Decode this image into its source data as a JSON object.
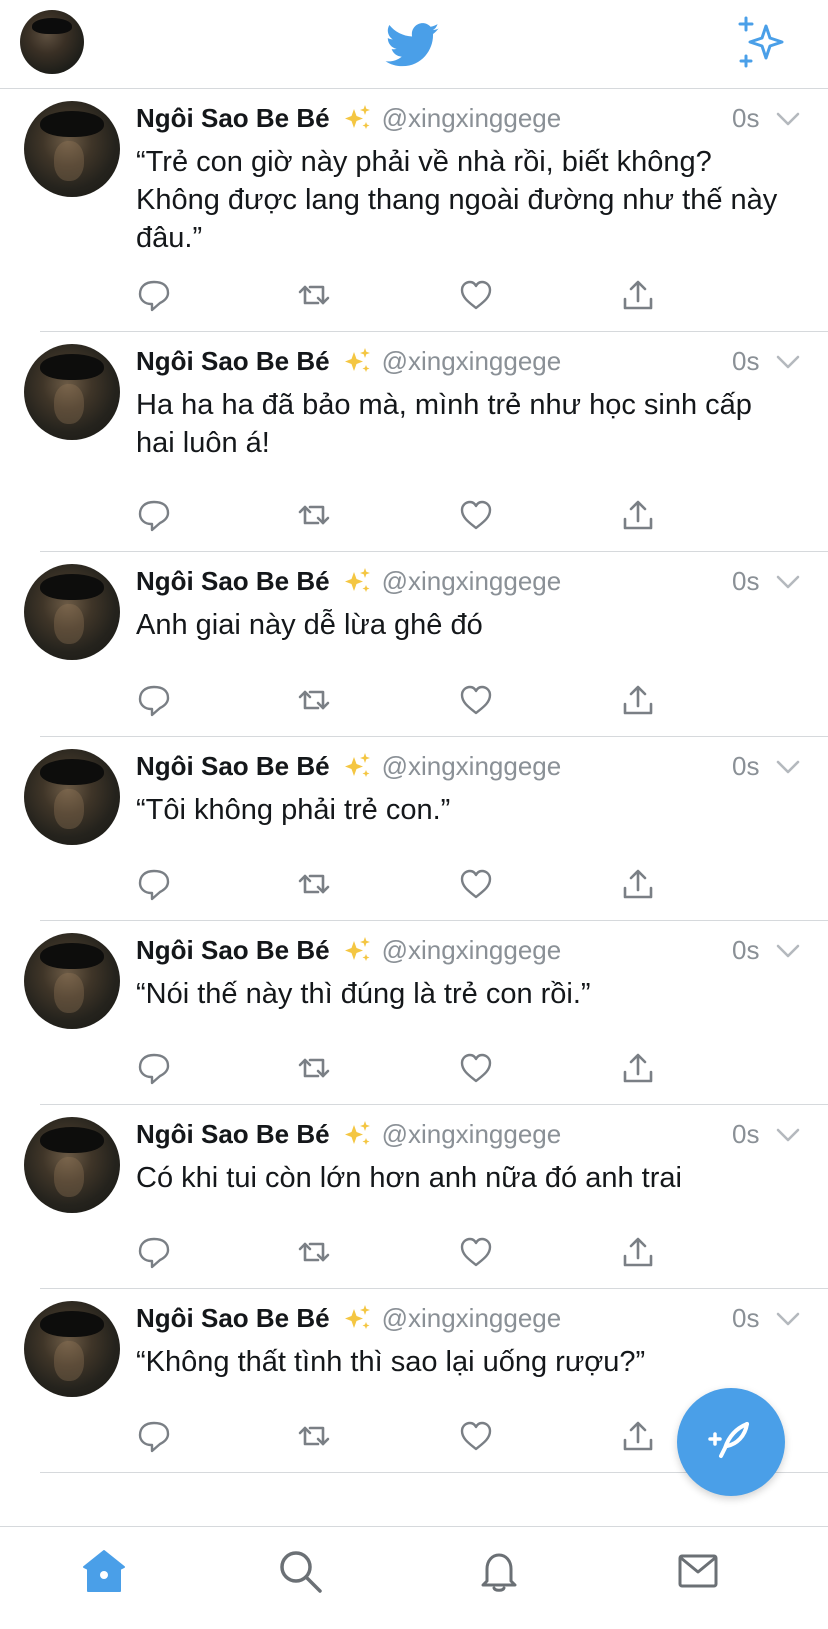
{
  "header": {
    "logo_icon": "twitter-bird-icon",
    "sparkle_icon": "sparkle-icon",
    "accent_color": "#4a9fe8"
  },
  "tweets": [
    {
      "name": "Ngôi Sao Be Bé",
      "handle": "@xingxinggege",
      "time": "0s",
      "text": "“Trẻ con giờ này phải về nhà rồi, biết không? Không được lang thang ngoài đường như thế này đâu.”"
    },
    {
      "name": "Ngôi Sao Be Bé",
      "handle": "@xingxinggege",
      "time": "0s",
      "text": "Ha ha ha đã bảo mà, mình trẻ như học sinh cấp hai luôn á!"
    },
    {
      "name": "Ngôi Sao Be Bé",
      "handle": "@xingxinggege",
      "time": "0s",
      "text": "Anh giai này dễ lừa ghê đó"
    },
    {
      "name": "Ngôi Sao Be Bé",
      "handle": "@xingxinggege",
      "time": "0s",
      "text": "“Tôi không phải trẻ con.”"
    },
    {
      "name": "Ngôi Sao Be Bé",
      "handle": "@xingxinggege",
      "time": "0s",
      "text": "“Nói thế này thì đúng là trẻ con rồi.”"
    },
    {
      "name": "Ngôi Sao Be Bé",
      "handle": "@xingxinggege",
      "time": "0s",
      "text": "Có khi tui còn lớn hơn anh nữa đó anh trai"
    },
    {
      "name": "Ngôi Sao Be Bé",
      "handle": "@xingxinggege",
      "time": "0s",
      "text": "“Không thất tình thì sao lại uống rượu?”"
    }
  ],
  "tabbar": {
    "items": [
      "home-icon",
      "search-icon",
      "bell-icon",
      "mail-icon"
    ],
    "active": "home-icon"
  },
  "fab_icon": "compose-tweet-icon"
}
